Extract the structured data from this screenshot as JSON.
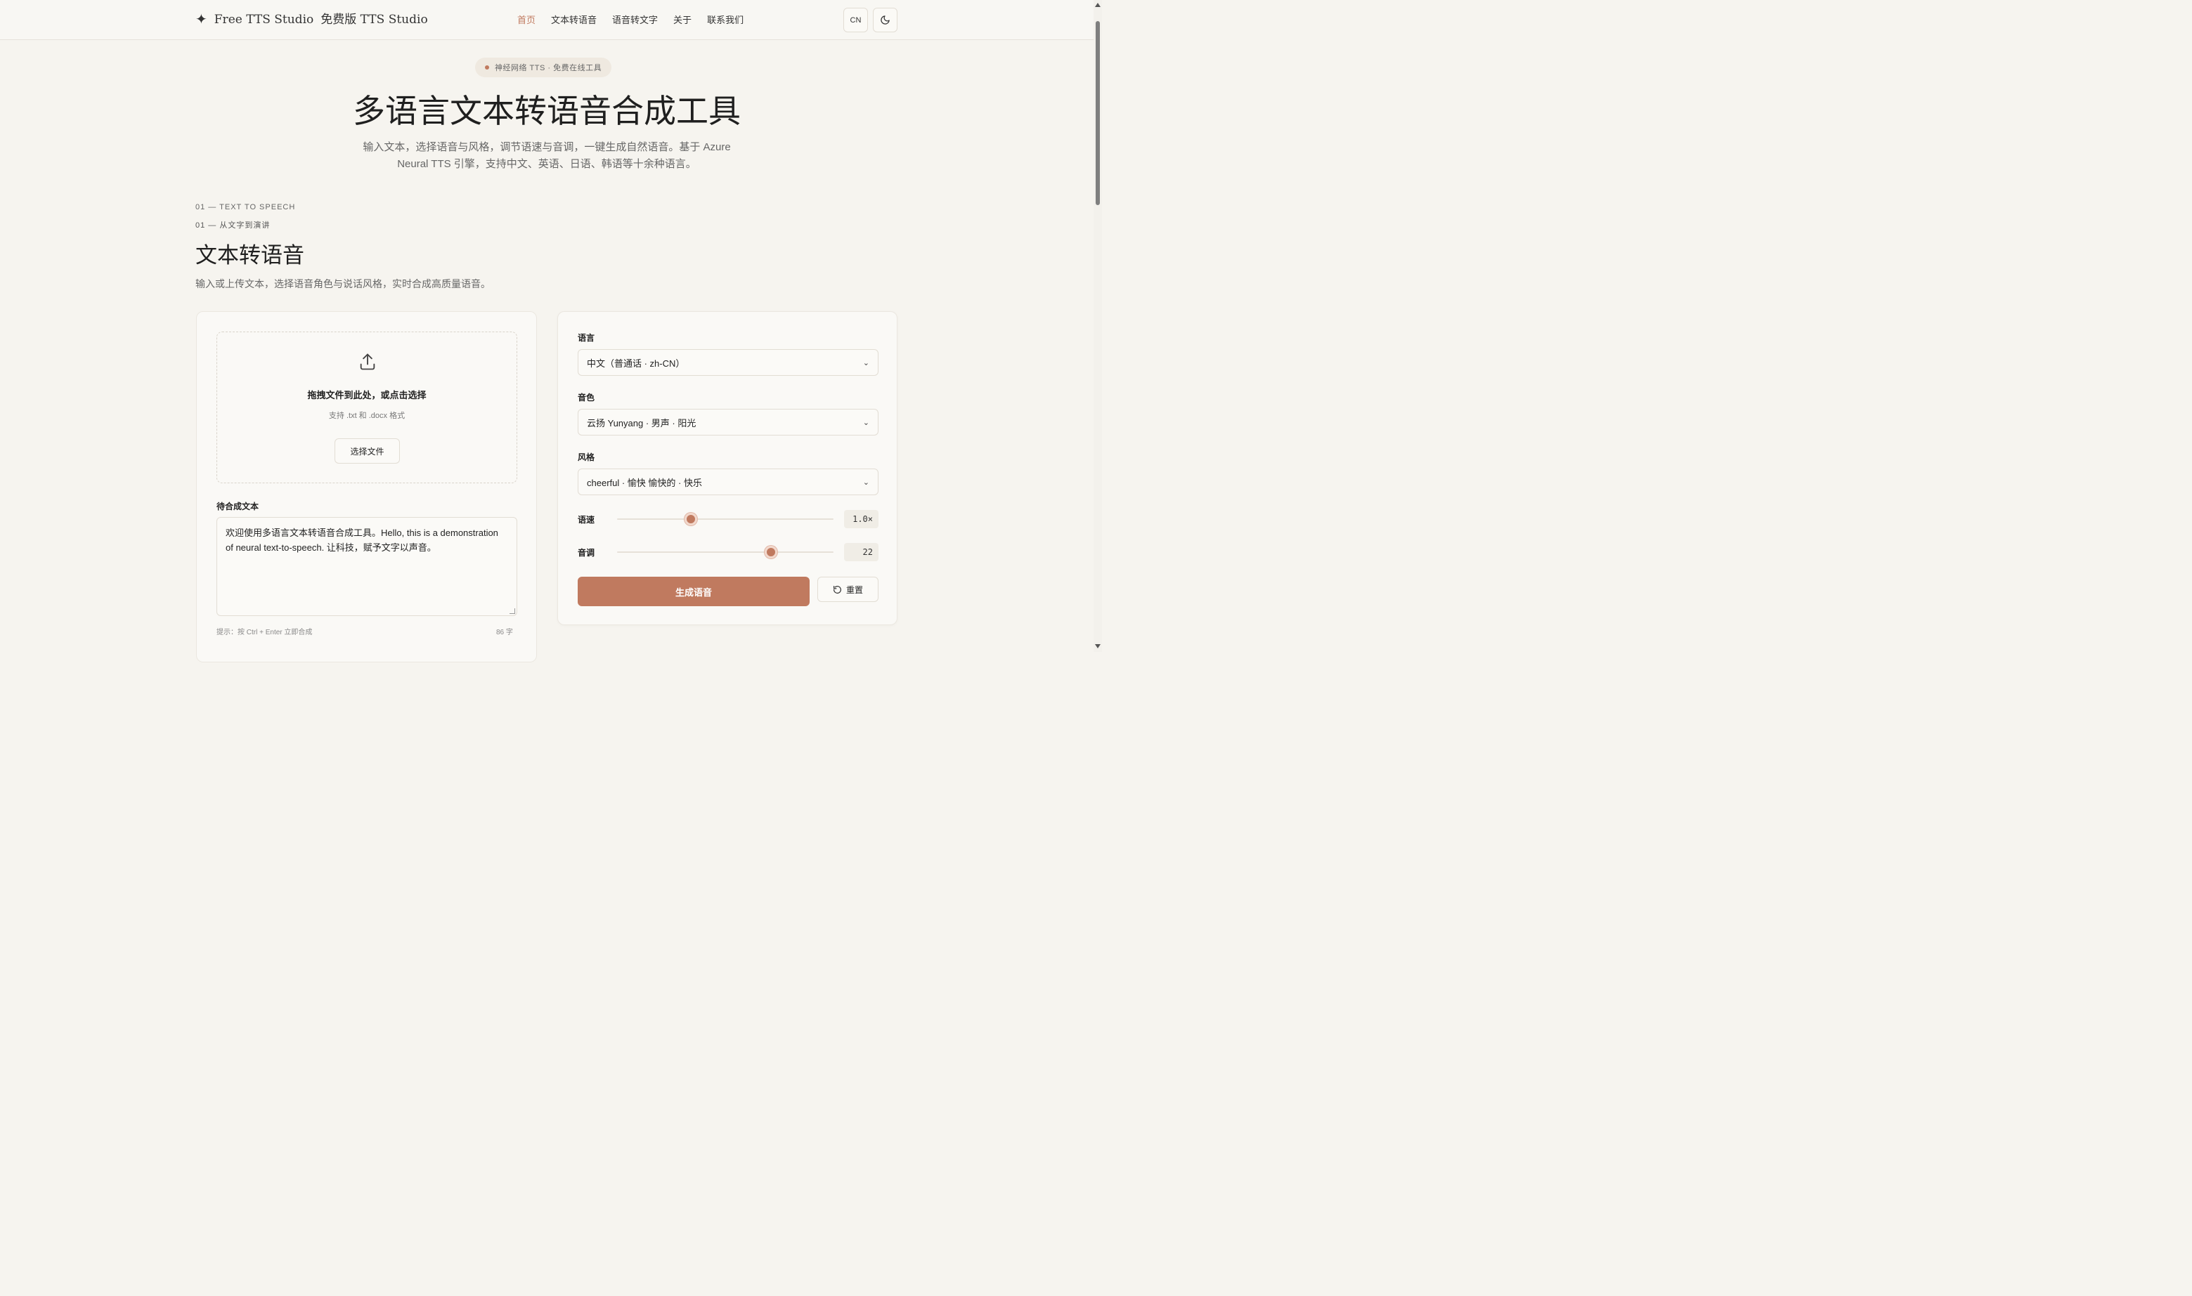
{
  "header": {
    "brand_en": "Free TTS Studio",
    "brand_cn": "免费版 TTS Studio",
    "nav": [
      {
        "label": "首页",
        "active": true
      },
      {
        "label": "文本转语音",
        "active": false
      },
      {
        "label": "语音转文字",
        "active": false
      },
      {
        "label": "关于",
        "active": false
      },
      {
        "label": "联系我们",
        "active": false
      }
    ],
    "lang_button": "CN"
  },
  "hero": {
    "badge": "神经网络 TTS · 免费在线工具",
    "title": "多语言文本转语音合成工具",
    "desc": "输入文本，选择语音与风格，调节语速与音调，一键生成自然语音。基于 Azure Neural TTS 引擎，支持中文、英语、日语、韩语等十余种语言。"
  },
  "section": {
    "eyebrow_en": "01 — TEXT TO SPEECH",
    "eyebrow_cn": "01 — 从文字到演讲",
    "title": "文本转语音",
    "desc": "输入或上传文本，选择语音角色与说话风格，实时合成高质量语音。"
  },
  "upload": {
    "title": "拖拽文件到此处，或点击选择",
    "hint": "支持 .txt 和 .docx 格式",
    "button": "选择文件"
  },
  "text": {
    "label": "待合成文本",
    "value": "欢迎使用多语言文本转语音合成工具。Hello, this is a demonstration of neural text-to-speech. 让科技，赋予文字以声音。",
    "tip": "提示：按 Ctrl + Enter 立即合成",
    "count": "86 字"
  },
  "settings": {
    "language_label": "语言",
    "language_value": "中文（普通话 · zh-CN）",
    "voice_label": "音色",
    "voice_value": "云扬 Yunyang · 男声 · 阳光",
    "style_label": "风格",
    "style_value": "cheerful · 愉快  愉快的 · 快乐",
    "speed_label": "语速",
    "speed_value": "1.0×",
    "speed_level": 0.34,
    "pitch_label": "音调",
    "pitch_value": "22",
    "pitch_level": 0.71,
    "generate": "生成语音",
    "reset": "重置"
  },
  "colors": {
    "accent": "#c07a5f",
    "background": "#f6f4ef"
  }
}
